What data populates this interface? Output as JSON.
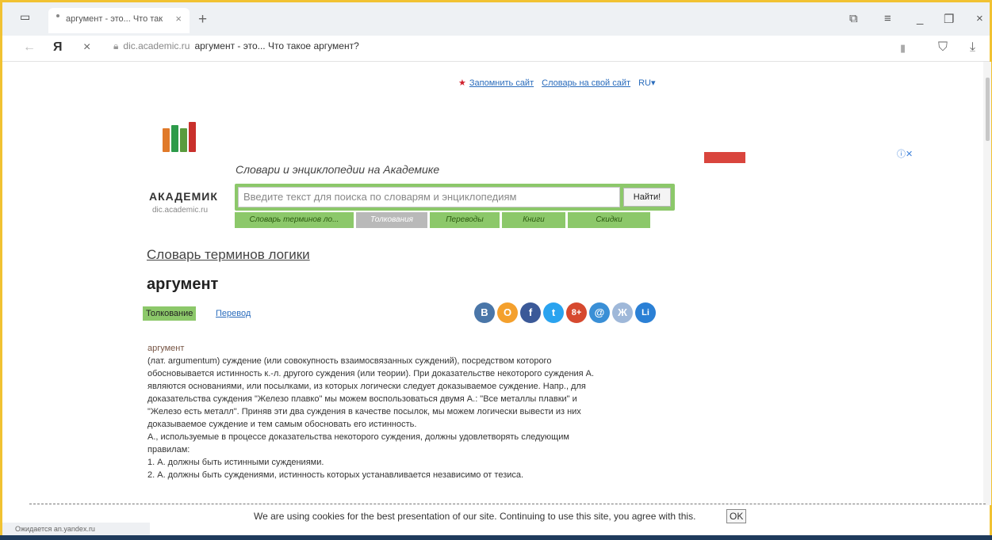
{
  "browser": {
    "tab_title": "аргумент - это... Что так",
    "tab_close": "×",
    "new_tab": "+",
    "url_domain": "dic.academic.ru",
    "url_title": "аргумент - это... Что такое аргумент?",
    "back_icon": "back-arrow-icon",
    "yandex_icon": "Я",
    "stop_icon": "×"
  },
  "site": {
    "remember": "Запомнить сайт",
    "dict_on_site": "Словарь на свой сайт",
    "lang": "RU",
    "brand": "АКАДЕМИК",
    "brand_sub": "dic.academic.ru",
    "tagline": "Словари и энциклопедии на Академике",
    "search_placeholder": "Введите текст для поиска по словарям и энциклопедиям",
    "search_button": "Найти!",
    "categories": [
      "Словарь терминов ло...",
      "Толкования",
      "Переводы",
      "Книги",
      "Скидки"
    ],
    "ad_info": "ⓘ✕"
  },
  "article": {
    "dictionary": "Словарь терминов логики",
    "word": "аргумент",
    "tab_interpretation": "Толкование",
    "tab_translation": "Перевод",
    "social": [
      "В",
      "О",
      "f",
      "t",
      "8+",
      "@",
      "Ж",
      "Li"
    ],
    "head": "аргумент",
    "lines": [
      "(лат. argumentum) суждение (или совокупность взаимосвязанных суждений), посредством которого",
      "обосновывается истинность к.-л. другого суждения (или теории). При доказательстве некоторого суждения А.",
      "являются основаниями, или посылками, из которых логически следует доказываемое суждение. Напр., для",
      "доказательства суждения \"Железо плавко\" мы можем воспользоваться двумя А.: \"Все металлы плавки\" и",
      "\"Железо есть металл\". Приняв эти два суждения в качестве посылок, мы можем логически вывести из них",
      "доказываемое суждение и тем самым обосновать его истинность.",
      "А., используемые в процессе доказательства некоторого суждения, должны удовлетворять следующим",
      "правилам:",
      "1. А. должны быть истинными суждениями.",
      "2. А. должны быть суждениями, истинность которых устанавливается независимо от тезиса."
    ]
  },
  "cookie": {
    "text": "We are using cookies for the best presentation of our site. Continuing to use this site, you agree with this.",
    "ok": "OK"
  },
  "status": "Ожидается an.yandex.ru"
}
